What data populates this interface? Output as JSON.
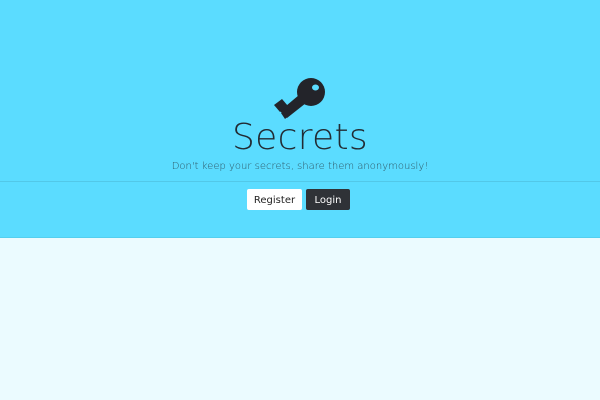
{
  "hero": {
    "icon": "key-icon",
    "title": "Secrets",
    "tagline": "Don't keep your secrets, share them anonymously!"
  },
  "actions": {
    "register_label": "Register",
    "login_label": "Login"
  },
  "colors": {
    "hero_background": "#5bdcff",
    "page_background": "#ebfbff",
    "register_button_bg": "#ffffff",
    "login_button_bg": "#2f3237",
    "text_dark": "#222b33"
  }
}
